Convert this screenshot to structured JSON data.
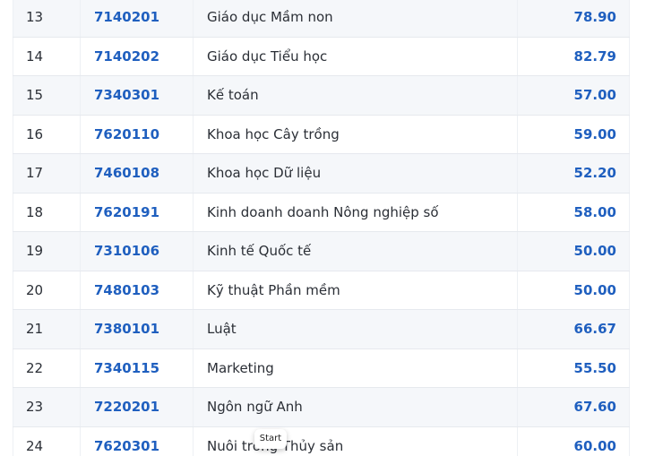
{
  "rows": [
    {
      "stt": "13",
      "code": "7140201",
      "name": "Giáo dục Mầm non",
      "score": "78.90"
    },
    {
      "stt": "14",
      "code": "7140202",
      "name": "Giáo dục Tiểu học",
      "score": "82.79"
    },
    {
      "stt": "15",
      "code": "7340301",
      "name": "Kế toán",
      "score": "57.00"
    },
    {
      "stt": "16",
      "code": "7620110",
      "name": "Khoa học Cây trồng",
      "score": "59.00"
    },
    {
      "stt": "17",
      "code": "7460108",
      "name": "Khoa học Dữ liệu",
      "score": "52.20"
    },
    {
      "stt": "18",
      "code": "7620191",
      "name": "Kinh doanh doanh Nông nghiệp số",
      "score": "58.00"
    },
    {
      "stt": "19",
      "code": "7310106",
      "name": "Kinh tế Quốc tế",
      "score": "50.00"
    },
    {
      "stt": "20",
      "code": "7480103",
      "name": "Kỹ thuật Phần mềm",
      "score": "50.00"
    },
    {
      "stt": "21",
      "code": "7380101",
      "name": "Luật",
      "score": "66.67"
    },
    {
      "stt": "22",
      "code": "7340115",
      "name": "Marketing",
      "score": "55.50"
    },
    {
      "stt": "23",
      "code": "7220201",
      "name": "Ngôn ngữ Anh",
      "score": "67.60"
    },
    {
      "stt": "24",
      "code": "7620301",
      "name": "Nuôi trồng Thủy sản",
      "score": "60.00"
    }
  ],
  "tooltip": {
    "label": "Start"
  },
  "colors": {
    "accent": "#1f5fbf",
    "stripe": "#f5f7fa",
    "border": "#e6e9ee"
  }
}
